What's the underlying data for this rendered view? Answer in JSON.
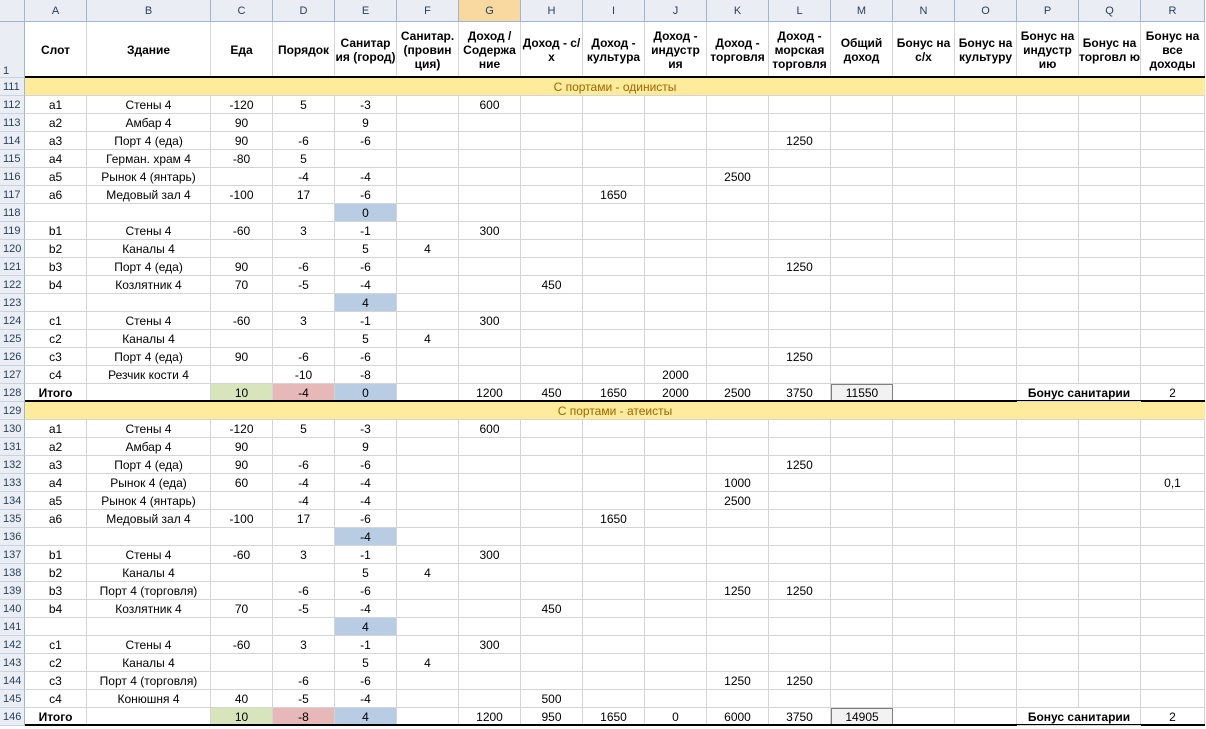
{
  "columns": [
    "A",
    "B",
    "C",
    "D",
    "E",
    "F",
    "G",
    "H",
    "I",
    "J",
    "K",
    "L",
    "M",
    "N",
    "O",
    "P",
    "Q",
    "R"
  ],
  "selected_column": "G",
  "header_row": {
    "row_number": "1",
    "labels": [
      "Слот",
      "Здание",
      "Еда",
      "Порядок",
      "Санитар ия (город)",
      "Санитар. (провин ция)",
      "Доход / Содержа ние",
      "Доход - с/х",
      "Доход - культура",
      "Доход - индустр ия",
      "Доход - торговля",
      "Доход - морская торговля",
      "Общий доход",
      "Бонус на с/х",
      "Бонус на культуру",
      "Бонус на индустр ию",
      "Бонус на торговл ю",
      "Бонус на все доходы"
    ]
  },
  "rows": [
    {
      "n": "111",
      "banner": "С портами - одинисты"
    },
    {
      "n": "112",
      "cells": {
        "A": "a1",
        "B": "Стены 4",
        "C": "-120",
        "D": "5",
        "E": "-3",
        "G": "600"
      }
    },
    {
      "n": "113",
      "cells": {
        "A": "a2",
        "B": "Амбар 4",
        "C": "90",
        "E": "9"
      }
    },
    {
      "n": "114",
      "cells": {
        "A": "a3",
        "B": "Порт 4 (еда)",
        "C": "90",
        "D": "-6",
        "E": "-6",
        "L": "1250"
      }
    },
    {
      "n": "115",
      "cells": {
        "A": "a4",
        "B": "Герман. храм 4",
        "C": "-80",
        "D": "5"
      }
    },
    {
      "n": "116",
      "cells": {
        "A": "a5",
        "B": "Рынок 4 (янтарь)",
        "D": "-4",
        "E": "-4",
        "K": "2500"
      }
    },
    {
      "n": "117",
      "cells": {
        "A": "a6",
        "B": "Медовый зал 4",
        "C": "-100",
        "D": "17",
        "E": "-6",
        "I": "1650"
      }
    },
    {
      "n": "118",
      "cells": {
        "E": "0"
      },
      "fills": {
        "E": "blue"
      }
    },
    {
      "n": "119",
      "cells": {
        "A": "b1",
        "B": "Стены 4",
        "C": "-60",
        "D": "3",
        "E": "-1",
        "G": "300"
      }
    },
    {
      "n": "120",
      "cells": {
        "A": "b2",
        "B": "Каналы 4",
        "E": "5",
        "F": "4"
      }
    },
    {
      "n": "121",
      "cells": {
        "A": "b3",
        "B": "Порт 4 (еда)",
        "C": "90",
        "D": "-6",
        "E": "-6",
        "L": "1250"
      }
    },
    {
      "n": "122",
      "cells": {
        "A": "b4",
        "B": "Козлятник 4",
        "C": "70",
        "D": "-5",
        "E": "-4",
        "H": "450"
      }
    },
    {
      "n": "123",
      "cells": {
        "E": "4"
      },
      "fills": {
        "E": "blue"
      }
    },
    {
      "n": "124",
      "cells": {
        "A": "c1",
        "B": "Стены 4",
        "C": "-60",
        "D": "3",
        "E": "-1",
        "G": "300"
      }
    },
    {
      "n": "125",
      "cells": {
        "A": "c2",
        "B": "Каналы 4",
        "E": "5",
        "F": "4"
      }
    },
    {
      "n": "126",
      "cells": {
        "A": "c3",
        "B": "Порт 4 (еда)",
        "C": "90",
        "D": "-6",
        "E": "-6",
        "L": "1250"
      }
    },
    {
      "n": "127",
      "cells": {
        "A": "c4",
        "B": "Резчик кости 4",
        "D": "-10",
        "E": "-8",
        "J": "2000"
      }
    },
    {
      "n": "128",
      "total": true,
      "cells": {
        "A": "Итого",
        "C": "10",
        "D": "-4",
        "E": "0",
        "G": "1200",
        "H": "450",
        "I": "1650",
        "J": "2000",
        "K": "2500",
        "L": "3750",
        "M": "11550",
        "P": "Бонус санитарии",
        "R": "2"
      },
      "fills": {
        "C": "green",
        "D": "red",
        "E": "blue",
        "M": "gray"
      }
    },
    {
      "n": "129",
      "banner": "С портами - атеисты"
    },
    {
      "n": "130",
      "cells": {
        "A": "a1",
        "B": "Стены 4",
        "C": "-120",
        "D": "5",
        "E": "-3",
        "G": "600"
      }
    },
    {
      "n": "131",
      "cells": {
        "A": "a2",
        "B": "Амбар 4",
        "C": "90",
        "E": "9"
      }
    },
    {
      "n": "132",
      "cells": {
        "A": "a3",
        "B": "Порт 4 (еда)",
        "C": "90",
        "D": "-6",
        "E": "-6",
        "L": "1250"
      }
    },
    {
      "n": "133",
      "cells": {
        "A": "a4",
        "B": "Рынок 4 (еда)",
        "C": "60",
        "D": "-4",
        "E": "-4",
        "K": "1000",
        "R": "0,1"
      }
    },
    {
      "n": "134",
      "cells": {
        "A": "a5",
        "B": "Рынок 4 (янтарь)",
        "D": "-4",
        "E": "-4",
        "K": "2500"
      }
    },
    {
      "n": "135",
      "cells": {
        "A": "a6",
        "B": "Медовый зал 4",
        "C": "-100",
        "D": "17",
        "E": "-6",
        "I": "1650"
      }
    },
    {
      "n": "136",
      "cells": {
        "E": "-4"
      },
      "fills": {
        "E": "blue"
      }
    },
    {
      "n": "137",
      "cells": {
        "A": "b1",
        "B": "Стены 4",
        "C": "-60",
        "D": "3",
        "E": "-1",
        "G": "300"
      }
    },
    {
      "n": "138",
      "cells": {
        "A": "b2",
        "B": "Каналы 4",
        "E": "5",
        "F": "4"
      }
    },
    {
      "n": "139",
      "cells": {
        "A": "b3",
        "B": "Порт 4 (торговля)",
        "D": "-6",
        "E": "-6",
        "K": "1250",
        "L": "1250"
      }
    },
    {
      "n": "140",
      "cells": {
        "A": "b4",
        "B": "Козлятник 4",
        "C": "70",
        "D": "-5",
        "E": "-4",
        "H": "450"
      }
    },
    {
      "n": "141",
      "cells": {
        "E": "4"
      },
      "fills": {
        "E": "blue"
      }
    },
    {
      "n": "142",
      "cells": {
        "A": "c1",
        "B": "Стены 4",
        "C": "-60",
        "D": "3",
        "E": "-1",
        "G": "300"
      }
    },
    {
      "n": "143",
      "cells": {
        "A": "c2",
        "B": "Каналы 4",
        "E": "5",
        "F": "4"
      }
    },
    {
      "n": "144",
      "cells": {
        "A": "c3",
        "B": "Порт 4 (торговля)",
        "D": "-6",
        "E": "-6",
        "K": "1250",
        "L": "1250"
      }
    },
    {
      "n": "145",
      "cells": {
        "A": "c4",
        "B": "Конюшня 4",
        "C": "40",
        "D": "-5",
        "E": "-4",
        "H": "500"
      }
    },
    {
      "n": "146",
      "total": true,
      "cells": {
        "A": "Итого",
        "C": "10",
        "D": "-8",
        "E": "4",
        "G": "1200",
        "H": "950",
        "I": "1650",
        "J": "0",
        "K": "6000",
        "L": "3750",
        "M": "14905",
        "P": "Бонус санитарии",
        "R": "2"
      },
      "fills": {
        "C": "green",
        "D": "red",
        "E": "blue",
        "M": "gray"
      }
    }
  ],
  "colors": {
    "green": "#d8e4bc",
    "red": "#e6b8b7",
    "blue": "#b8cce4",
    "gray": "#f2f2f2",
    "banner": "#ffeb9c",
    "banner_text": "#9c6500",
    "header_bg": "#eaeef4",
    "selected_header": "#f9d99f"
  }
}
